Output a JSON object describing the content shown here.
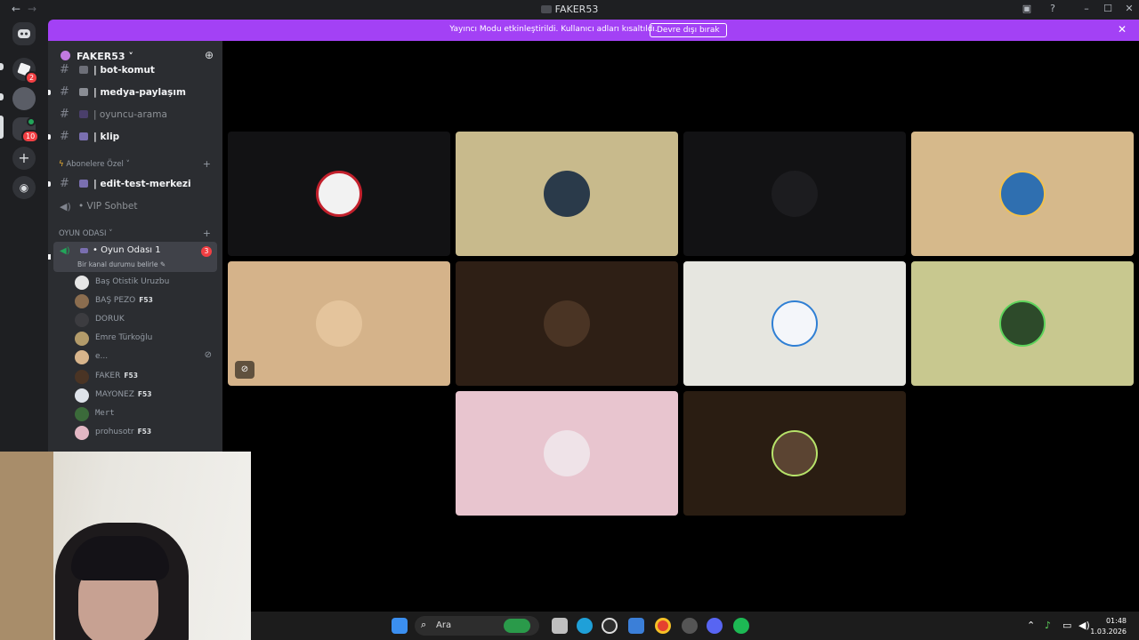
{
  "window": {
    "title": "FAKER53"
  },
  "banner": {
    "message": "Yayıncı Modu etkinleştirildi. Kullanıcı adları kısaltıldı.",
    "button_label": "Devre dışı bırak"
  },
  "rail": {
    "badges": {
      "server1": "2",
      "server3": "10"
    }
  },
  "server": {
    "name": "FAKER53 ˅"
  },
  "channels": {
    "bot": "| bot-komut",
    "medya": "| medya-paylaşım",
    "oyuncu": "| oyuncu-arama",
    "klip": "| klip",
    "cat_abone": "Abonelere Özel ˅",
    "edit": "| edit-test-merkezi",
    "vip": "• VIP Sohbet",
    "cat_oyun": "OYUN ODASI ˅",
    "voice_name": "• Oyun Odası 1",
    "voice_count": "3",
    "voice_status": "Bir kanal durumu belirle ✎"
  },
  "voice_members": [
    {
      "name": "Baş Otistik Uruzbu",
      "tag": ""
    },
    {
      "name": "BAŞ PEZO",
      "tag": "F53"
    },
    {
      "name": "DORUK",
      "tag": ""
    },
    {
      "name": "Emre Türkoğlu",
      "tag": ""
    },
    {
      "name": "e...",
      "tag": ""
    },
    {
      "name": "FAKER",
      "tag": "F53"
    },
    {
      "name": "MAYONEZ",
      "tag": "F53"
    },
    {
      "name": "Mert",
      "tag": ""
    },
    {
      "name": "prohusotr",
      "tag": "F53"
    }
  ],
  "taskbar": {
    "search_placeholder": "Ara",
    "time": "01:48",
    "date": "1.03.2026"
  },
  "colors": {
    "banner": "#a341f5",
    "tile_tan": "#c8ba8c",
    "tile_dark": "#121214",
    "tile_beige": "#d6b98b",
    "tile_peach": "#d5b38a",
    "tile_brown": "#2e1f15",
    "tile_grey": "#e6e6e0",
    "tile_olive": "#c8c88f",
    "tile_pink": "#e8c5cf"
  }
}
